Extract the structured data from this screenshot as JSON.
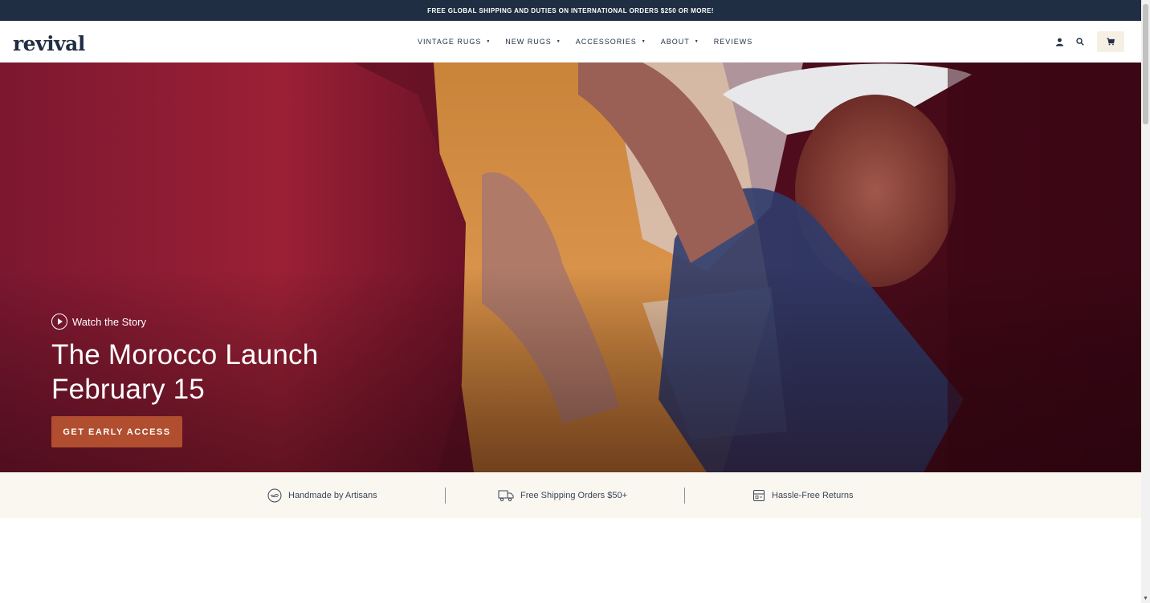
{
  "announcement": "FREE GLOBAL SHIPPING AND DUTIES ON INTERNATIONAL ORDERS $250 OR MORE!",
  "header": {
    "logo": "revival",
    "nav": [
      {
        "label": "VINTAGE RUGS",
        "has_caret": true
      },
      {
        "label": "NEW RUGS",
        "has_caret": true
      },
      {
        "label": "ACCESSORIES",
        "has_caret": true
      },
      {
        "label": "ABOUT",
        "has_caret": true
      },
      {
        "label": "REVIEWS",
        "has_caret": false
      }
    ],
    "icons": [
      "account-icon",
      "search-icon",
      "cart-icon"
    ]
  },
  "hero": {
    "watch_label": "Watch the Story",
    "title_line1": "The Morocco Launch",
    "title_line2": "February 15",
    "cta_label": "GET EARLY ACCESS",
    "cta_color": "#b04e2f"
  },
  "features": [
    {
      "icon": "handmade-icon",
      "label": "Handmade by Artisans"
    },
    {
      "icon": "truck-icon",
      "label": "Free Shipping Orders $50+"
    },
    {
      "icon": "return-box-icon",
      "label": "Hassle-Free Returns"
    }
  ],
  "colors": {
    "announcement_bg": "#1f2e42",
    "features_bg": "#faf6f0",
    "cart_bg": "#f6efe4"
  }
}
